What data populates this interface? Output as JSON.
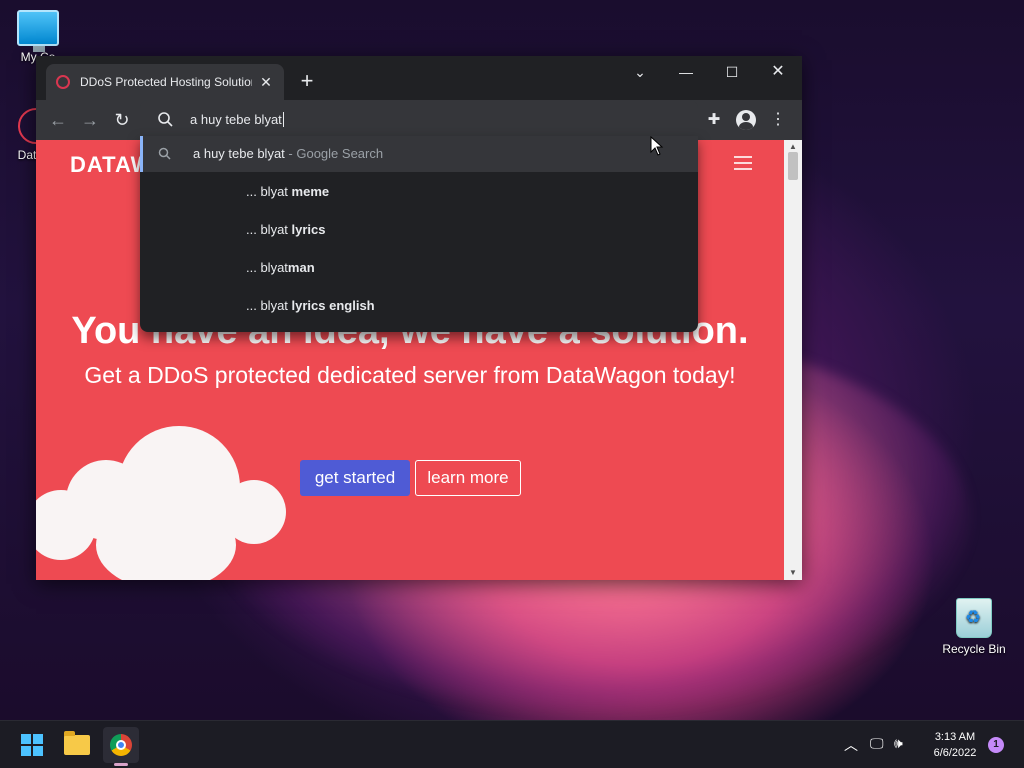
{
  "desktop": {
    "icons": [
      {
        "label": "My Co",
        "icon": "computer-icon"
      },
      {
        "label": "DataW",
        "icon": "datawagon-icon"
      },
      {
        "label": "Recycle Bin",
        "icon": "recycle-bin-icon"
      }
    ]
  },
  "browser": {
    "tab": {
      "title": "DDoS Protected Hosting Solution",
      "close": "✕"
    },
    "new_tab": "+",
    "window_controls": {
      "dropdown": "⌄",
      "minimize": "—",
      "maximize": "☐",
      "close": "✕"
    },
    "omnibox": {
      "value": "a huy tebe blyat"
    },
    "suggestions": [
      {
        "main": "a huy tebe blyat",
        "suffix": "- Google Search"
      },
      {
        "prefix": "... blyat ",
        "bold": "meme"
      },
      {
        "prefix": "... blyat ",
        "bold": "lyrics"
      },
      {
        "prefix": "... blyat",
        "bold": "man"
      },
      {
        "prefix": "... blyat ",
        "bold": "lyrics english"
      }
    ]
  },
  "page": {
    "brand": "DATAW",
    "hero_title": "You have an idea, we have a solution.",
    "hero_subtitle": "Get a DDoS protected dedicated server from DataWagon today!",
    "buttons": {
      "primary": "get started",
      "secondary": "learn more"
    },
    "colors": {
      "background": "#ee4a52",
      "primary_button": "#4f5bd5"
    }
  },
  "taskbar": {
    "time": "3:13 AM",
    "date": "6/6/2022",
    "notifications": "1",
    "apps": [
      "start-icon",
      "file-explorer-icon",
      "chrome-icon"
    ]
  }
}
